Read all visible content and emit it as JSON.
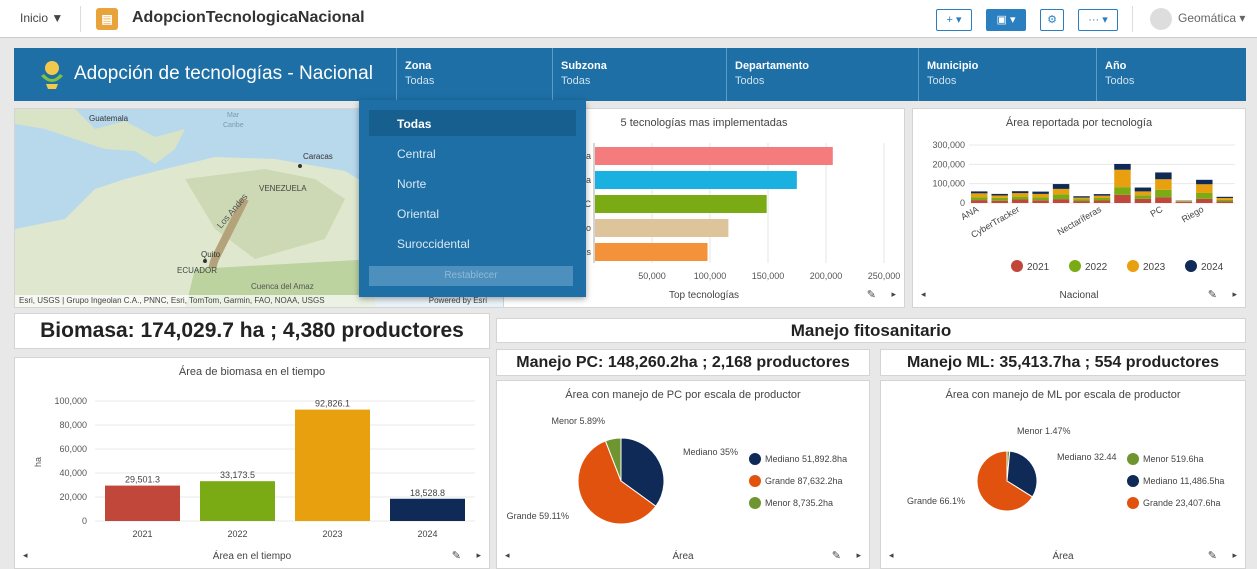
{
  "topbar": {
    "home": "Inicio",
    "home_caret": "▼",
    "app_title": "AdopcionTecnologicaNacional",
    "add": "+ ▾",
    "save": "▣ ▾",
    "settings": "⚙",
    "more": "··· ▾",
    "user": "Geomática",
    "user_caret": "▾"
  },
  "header": {
    "title": "Adopción de tecnologías - Nacional",
    "filters": [
      {
        "label": "Zona",
        "value": "Todas"
      },
      {
        "label": "Subzona",
        "value": "Todas"
      },
      {
        "label": "Departamento",
        "value": "Todos"
      },
      {
        "label": "Municipio",
        "value": "Todos"
      },
      {
        "label": "Año",
        "value": "Todos"
      }
    ]
  },
  "dropdown": {
    "options": [
      "Todas",
      "Central",
      "Norte",
      "Oriental",
      "Suroccidental"
    ],
    "reset": "Restablecer"
  },
  "map": {
    "labels": [
      "Guatemala",
      "Mar",
      "Caribe",
      "Caracas",
      "VENEZUELA",
      "Los Andes",
      "Quito",
      "ECUADOR",
      "Cuenca del Amaz"
    ],
    "attribution": "Esri, USGS | Grupo Ingeolan C.A., PNNC, Esri, TomTom, Garmin, FAO, NOAA, USGS",
    "powered": "Powered by Esri"
  },
  "top5": {
    "title": "5 tecnologías mas implementadas",
    "footer": "Top tecnologías",
    "labels": [
      "ada",
      "nasa",
      "PC",
      "imo",
      "ajes"
    ],
    "ticks": [
      "50,000",
      "100,000",
      "150,000",
      "200,000",
      "250,000"
    ]
  },
  "area_tec": {
    "title": "Área reportada por tecnología",
    "footer": "Nacional",
    "yticks": [
      "300,000",
      "200,000",
      "100,000",
      "0"
    ],
    "xlabels": [
      "ANA",
      "CyberTracker",
      "Nectaríferas",
      "PC",
      "Riego"
    ],
    "legend": [
      "2021",
      "2022",
      "2023",
      "2024"
    ]
  },
  "biomasa": {
    "headline": "Biomasa: 174,029.7 ha ; 4,380 productores"
  },
  "manejo": {
    "headline": "Manejo fitosanitario",
    "pc": "Manejo PC: 148,260.2ha ; 2,168 productores",
    "ml": "Manejo ML: 35,413.7ha ; 554 productores"
  },
  "bio_chart": {
    "title": "Área de biomasa en el tiempo",
    "footer": "Área en el tiempo",
    "ylabel": "ha",
    "yticks": [
      "100,000",
      "80,000",
      "60,000",
      "40,000",
      "20,000",
      "0"
    ],
    "labels": [
      "29,501.3",
      "33,173.5",
      "92,826.1",
      "18,528.8"
    ],
    "years": [
      "2021",
      "2022",
      "2023",
      "2024"
    ]
  },
  "pie_pc": {
    "title": "Área con manejo de PC por escala de productor",
    "footer": "Área",
    "slice_labels": [
      "Menor 5.89%",
      "Mediano 35%",
      "Grande 59.11%"
    ],
    "legend": [
      "Mediano 51,892.8ha",
      "Grande 87,632.2ha",
      "Menor 8,735.2ha"
    ]
  },
  "pie_ml": {
    "title": "Área con manejo de ML por escala de productor",
    "footer": "Área",
    "slice_labels": [
      "Menor 1.47%",
      "Mediano 32.44",
      "Grande 66.1%"
    ],
    "legend": [
      "Menor 519.6ha",
      "Mediano 11,486.5ha",
      "Grande 23,407.6ha"
    ]
  },
  "footer_icons": {
    "left": "◂",
    "right": "▸",
    "edit": "✎"
  },
  "colors": {
    "header": "#1d6fa5",
    "c2021": "#c0473a",
    "c2022": "#7aab14",
    "c2023": "#e8a00e",
    "c2024": "#0f2a56",
    "grande": "#e1520f",
    "mediano": "#0f2a56",
    "menor": "#6f9530"
  },
  "chart_data": [
    {
      "type": "bar",
      "orientation": "horizontal",
      "title": "5 tecnologías mas implementadas",
      "categories": [
        "ada",
        "nasa",
        "PC",
        "imo",
        "ajes"
      ],
      "values": [
        205000,
        174000,
        148000,
        115000,
        97000
      ],
      "xlim": [
        0,
        250000
      ]
    },
    {
      "type": "bar",
      "stacked": true,
      "title": "Área reportada por tecnología",
      "categories": [
        "ANA",
        "",
        "CyberTracker",
        "",
        "",
        "",
        "Nectaríferas",
        "",
        "",
        "PC",
        "",
        "Riego",
        ""
      ],
      "series": [
        {
          "name": "2021",
          "values": [
            15000,
            12000,
            18000,
            14000,
            20000,
            10000,
            13000,
            42000,
            22000,
            30000,
            5000,
            22000,
            8000
          ]
        },
        {
          "name": "2022",
          "values": [
            15000,
            15000,
            15000,
            15000,
            25000,
            10000,
            13000,
            40000,
            18000,
            38000,
            2000,
            30000,
            8000
          ]
        },
        {
          "name": "2023",
          "values": [
            20000,
            12000,
            18000,
            18000,
            28000,
            8000,
            12000,
            90000,
            20000,
            55000,
            3000,
            45000,
            10000
          ]
        },
        {
          "name": "2024",
          "values": [
            10000,
            8000,
            10000,
            12000,
            25000,
            7000,
            8000,
            30000,
            20000,
            35000,
            2000,
            23000,
            6000
          ]
        }
      ],
      "ylim": [
        0,
        300000
      ]
    },
    {
      "type": "bar",
      "title": "Área de biomasa en el tiempo",
      "ylabel": "ha",
      "categories": [
        "2021",
        "2022",
        "2023",
        "2024"
      ],
      "values": [
        29501.3,
        33173.5,
        92826.1,
        18528.8
      ],
      "ylim": [
        0,
        100000
      ]
    },
    {
      "type": "pie",
      "title": "Área con manejo de PC por escala de productor",
      "categories": [
        "Mediano",
        "Grande",
        "Menor"
      ],
      "values": [
        51892.8,
        87632.2,
        8735.2
      ]
    },
    {
      "type": "pie",
      "title": "Área con manejo de ML por escala de productor",
      "categories": [
        "Menor",
        "Mediano",
        "Grande"
      ],
      "values": [
        519.6,
        11486.5,
        23407.6
      ]
    }
  ]
}
